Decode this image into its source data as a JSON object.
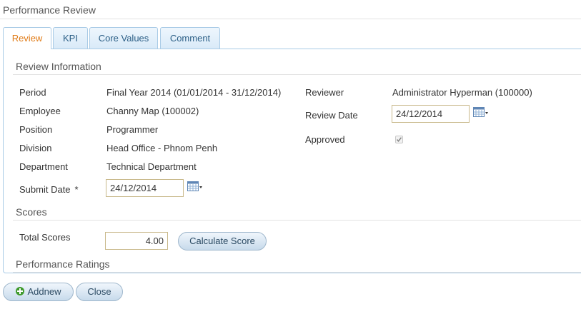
{
  "page": {
    "title": "Performance Review"
  },
  "tabs": [
    {
      "label": "Review",
      "active": true
    },
    {
      "label": "KPI",
      "active": false
    },
    {
      "label": "Core Values",
      "active": false
    },
    {
      "label": "Comment",
      "active": false
    }
  ],
  "review_info": {
    "section_title": "Review Information",
    "left": {
      "period": {
        "label": "Period",
        "value": "Final Year 2014 (01/01/2014 - 31/12/2014)"
      },
      "employee": {
        "label": "Employee",
        "value": "Channy Map (100002)"
      },
      "position": {
        "label": "Position",
        "value": "Programmer"
      },
      "division": {
        "label": "Division",
        "value": "Head Office - Phnom Penh"
      },
      "department": {
        "label": "Department",
        "value": "Technical Department"
      },
      "submit_date": {
        "label": "Submit Date",
        "required_mark": "*",
        "value": "24/12/2014"
      }
    },
    "right": {
      "reviewer": {
        "label": "Reviewer",
        "value": "Administrator Hyperman (100000)"
      },
      "review_date": {
        "label": "Review Date",
        "value": "24/12/2014"
      },
      "approved": {
        "label": "Approved",
        "checked": true,
        "disabled": true
      }
    }
  },
  "scores": {
    "section_title": "Scores",
    "total_label": "Total Scores",
    "total_value": "4.00",
    "calculate_label": "Calculate Score"
  },
  "ratings": {
    "section_title": "Performance Ratings"
  },
  "footer": {
    "addnew_label": "Addnew",
    "close_label": "Close"
  },
  "icons": {
    "calendar": "calendar-icon",
    "add": "plus-circle-icon",
    "check": "checkmark-icon"
  },
  "colors": {
    "tab_border": "#a9cbe6",
    "active_tab_text": "#e07b17",
    "tab_text": "#2c5f86",
    "input_border": "#c9b98b",
    "add_icon": "#3f9a2c"
  }
}
